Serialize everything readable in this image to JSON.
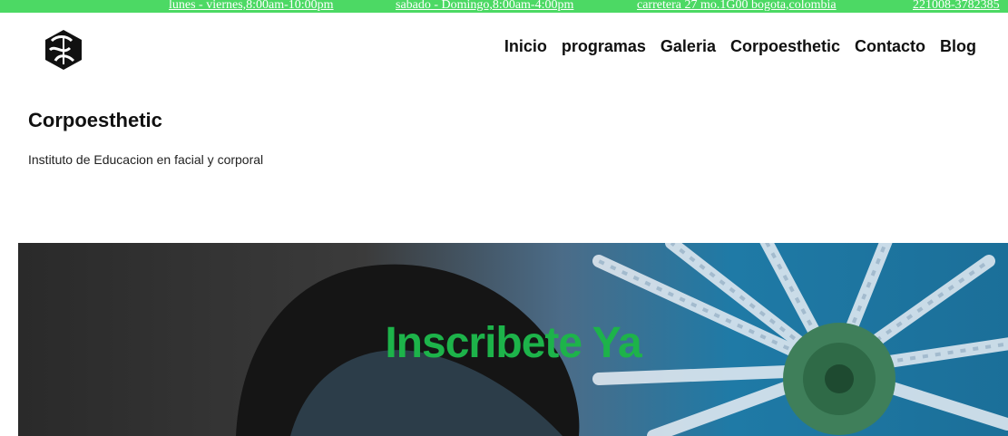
{
  "topbar": {
    "hours_weekdays": "lunes - viernes,8:00am-10:00pm",
    "hours_weekend": "sabado - Domingo,8:00am-4:00pm",
    "address": "carretera 27 mo.1G00 bogota,colombia",
    "phone": "221008-3782385"
  },
  "nav": {
    "items": [
      "Inicio",
      "programas",
      "Galeria",
      "Corpoesthetic",
      "Contacto",
      "Blog"
    ]
  },
  "site": {
    "title": "Corpoesthetic",
    "tagline": "Instituto de Educacion en facial y corporal"
  },
  "hero": {
    "cta": "Inscribete Ya"
  },
  "colors": {
    "accent": "#4cd964",
    "cta": "#1db34a"
  }
}
